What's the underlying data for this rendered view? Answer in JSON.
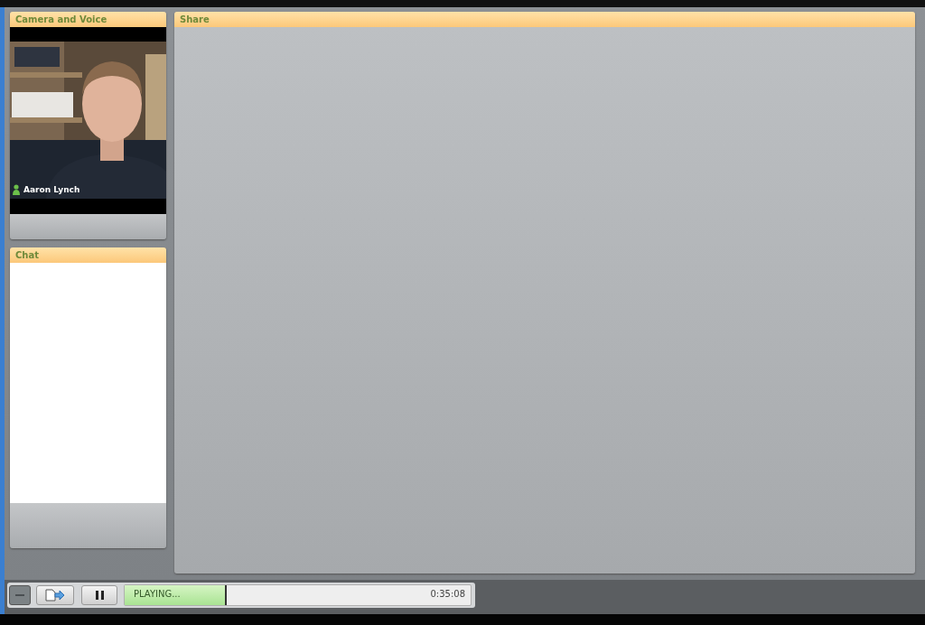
{
  "panels": [
    {
      "kind": "camera",
      "title": "Camera and Voice",
      "participant": "Aaron Lynch"
    },
    {
      "kind": "chat",
      "title": "Chat"
    }
  ],
  "share": {
    "title": "Share"
  },
  "player": {
    "status": "PLAYING...",
    "level": 0.29,
    "time": "0:35:08"
  }
}
